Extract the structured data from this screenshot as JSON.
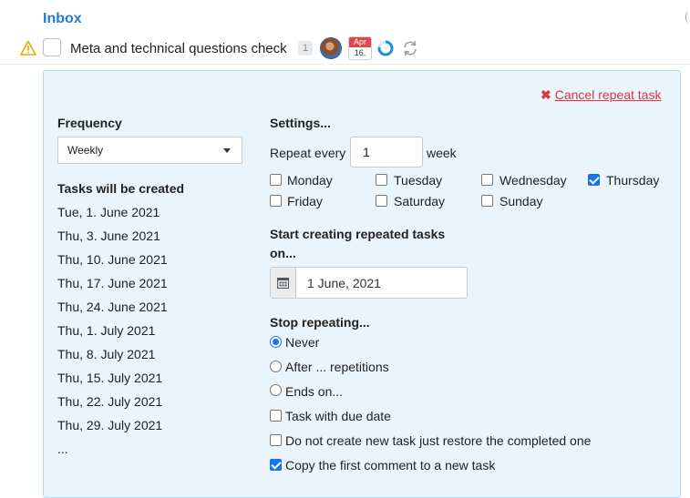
{
  "header": {
    "title": "Inbox"
  },
  "task": {
    "title": "Meta and technical questions check",
    "comment_count": "1",
    "calendar_month": "Apr",
    "calendar_day": "16.",
    "icons": [
      "warning-icon",
      "avatar",
      "calendar-icon",
      "progress-ring-icon",
      "repeat-icon"
    ]
  },
  "panel": {
    "cancel_label": "Cancel repeat task",
    "frequency_label": "Frequency",
    "frequency_value": "Weekly",
    "tasks_created_label": "Tasks will be created",
    "dates": [
      "Tue, 1. June 2021",
      "Thu, 3. June 2021",
      "Thu, 10. June 2021",
      "Thu, 17. June 2021",
      "Thu, 24. June 2021",
      "Thu, 1. July 2021",
      "Thu, 8. July 2021",
      "Thu, 15. July 2021",
      "Thu, 22. July 2021",
      "Thu, 29. July 2021",
      "..."
    ],
    "settings_label": "Settings...",
    "repeat_every_label": "Repeat every",
    "repeat_every_value": "1",
    "repeat_unit": "week",
    "days": [
      {
        "label": "Monday",
        "checked": false
      },
      {
        "label": "Tuesday",
        "checked": false
      },
      {
        "label": "Wednesday",
        "checked": false
      },
      {
        "label": "Thursday",
        "checked": true
      },
      {
        "label": "Friday",
        "checked": false
      },
      {
        "label": "Saturday",
        "checked": false
      },
      {
        "label": "Sunday",
        "checked": false
      }
    ],
    "start_label_line1": "Start creating repeated tasks",
    "start_label_line2": "on...",
    "start_date": "1 June, 2021",
    "stop_label": "Stop repeating...",
    "stop_options": [
      {
        "label": "Never",
        "checked": true
      },
      {
        "label": "After ... repetitions",
        "checked": false
      },
      {
        "label": "Ends on...",
        "checked": false
      }
    ],
    "extra_options": [
      {
        "label": "Task with due date",
        "checked": false
      },
      {
        "label": "Do not create new task just restore the completed one",
        "checked": false
      },
      {
        "label": "Copy the first comment to a new task",
        "checked": true
      }
    ]
  },
  "colors": {
    "accent": "#2a7cc8",
    "panel_bg": "#eaf4fd",
    "cancel": "#d63a3a",
    "warning": "#f0a500",
    "checkbox_checked": "#1a73e8"
  }
}
